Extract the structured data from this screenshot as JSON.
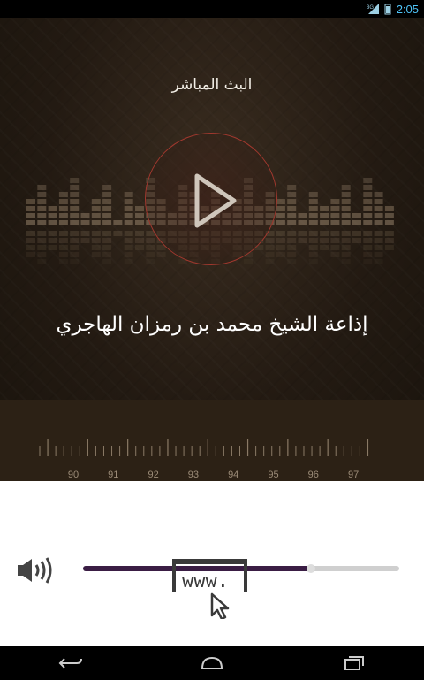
{
  "status_bar": {
    "network": "3G",
    "time": "2:05"
  },
  "player": {
    "live_title": "البث المباشر",
    "station_name": "إذاعة الشيخ محمد بن رمزان الهاجري",
    "play_icon": "play-icon",
    "frequencies": [
      "90",
      "91",
      "92",
      "93",
      "94",
      "95",
      "96",
      "97"
    ]
  },
  "controls": {
    "volume_icon": "speaker-icon",
    "progress": 0.72,
    "web_link_text": "www."
  },
  "nav": {
    "back_icon": "back-icon",
    "home_icon": "home-icon",
    "recents_icon": "recent-apps-icon"
  },
  "colors": {
    "accent": "#a0382e",
    "progress_fill": "#3a1d44",
    "dial_bg": "#2c2115"
  }
}
